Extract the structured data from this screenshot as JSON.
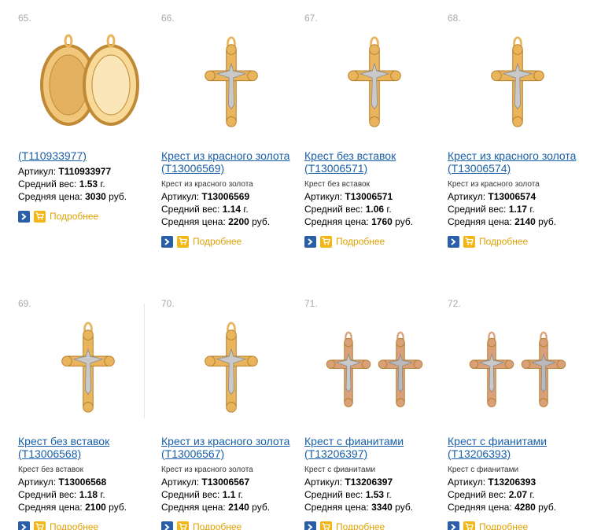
{
  "labels": {
    "article": "Артикул:",
    "weight": "Средний вес:",
    "price": "Средняя цена:",
    "more": "Подробнее",
    "g": "г.",
    "rub": "руб."
  },
  "colors": {
    "link": "#1a5fa8",
    "more": "#e0a200",
    "arrow_btn": "#2b5ea8",
    "cart_btn": "#f2b716",
    "gold": "#e9b45c",
    "silver": "#c9c9c9"
  },
  "products": [
    {
      "num": "65.",
      "title": "(T110933977)",
      "desc": "",
      "sku": "T110933977",
      "weight": "1.53",
      "price": "3030",
      "image": "medallion"
    },
    {
      "num": "66.",
      "title": "Крест из красного золота (T13006569)",
      "desc": "Крест из красного золота",
      "sku": "T13006569",
      "weight": "1.14",
      "price": "2200",
      "image": "cross"
    },
    {
      "num": "67.",
      "title": "Крест без вставок (T13006571)",
      "desc": "Крест без вставок",
      "sku": "T13006571",
      "weight": "1.06",
      "price": "1760",
      "image": "cross"
    },
    {
      "num": "68.",
      "title": "Крест из красного золота (T13006574)",
      "desc": "Крест из красного золота",
      "sku": "T13006574",
      "weight": "1.17",
      "price": "2140",
      "image": "cross"
    },
    {
      "num": "69.",
      "title": "Крест без вставок (T13006568)",
      "desc": "Крест без вставок",
      "sku": "T13006568",
      "weight": "1.18",
      "price": "2100",
      "image": "cross"
    },
    {
      "num": "70.",
      "title": "Крест из красного золота (T13006567)",
      "desc": "Крест из красного золота",
      "sku": "T13006567",
      "weight": "1.1",
      "price": "2140",
      "image": "cross"
    },
    {
      "num": "71.",
      "title": "Крест с фианитами (T13206397)",
      "desc": "Крест с фианитами",
      "sku": "T13206397",
      "weight": "1.53",
      "price": "3340",
      "image": "double-cross"
    },
    {
      "num": "72.",
      "title": "Крест с фианитами (T13206393)",
      "desc": "Крест с фианитами",
      "sku": "T13206393",
      "weight": "2.07",
      "price": "4280",
      "image": "double-cross"
    }
  ]
}
